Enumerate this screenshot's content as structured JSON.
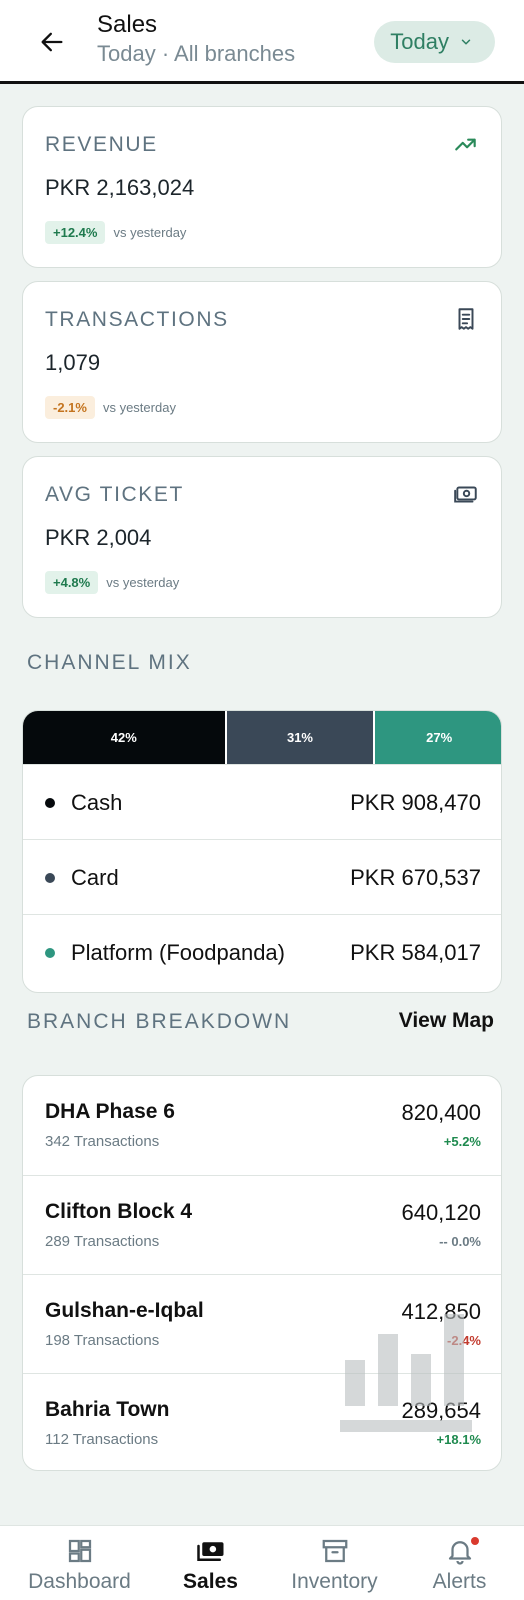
{
  "header": {
    "title": "Sales",
    "subtitle": "Today · All branches",
    "period_label": "Today"
  },
  "kpis": [
    {
      "label": "REVENUE",
      "value": "PKR 2,163,024",
      "change": "+12.4%",
      "direction": "up",
      "compare": "vs yesterday",
      "icon": "trending-up-icon"
    },
    {
      "label": "TRANSACTIONS",
      "value": "1,079",
      "change": "-2.1%",
      "direction": "down",
      "compare": "vs yesterday",
      "icon": "receipt-icon"
    },
    {
      "label": "AVG TICKET",
      "value": "PKR 2,004",
      "change": "+4.8%",
      "direction": "up",
      "compare": "vs yesterday",
      "icon": "cash-icon"
    }
  ],
  "channel_mix": {
    "title": "CHANNEL MIX",
    "segments": [
      {
        "percent_label": "42%",
        "share": 0.42,
        "color": "#05090c"
      },
      {
        "percent_label": "31%",
        "share": 0.31,
        "color": "#3a4857"
      },
      {
        "percent_label": "27%",
        "share": 0.27,
        "color": "#2e9680"
      }
    ],
    "rows": [
      {
        "name": "Cash",
        "amount": "PKR 908,470",
        "color": "#05090c"
      },
      {
        "name": "Card",
        "amount": "PKR 670,537",
        "color": "#3a4857"
      },
      {
        "name": "Platform (Foodpanda)",
        "amount": "PKR 584,017",
        "color": "#2e9680"
      }
    ]
  },
  "branches": {
    "title": "BRANCH BREAKDOWN",
    "view_map_label": "View Map",
    "rows": [
      {
        "name": "DHA Phase 6",
        "transactions": "342 Transactions",
        "amount": "820,400",
        "change": "+5.2%",
        "trend": "pos"
      },
      {
        "name": "Clifton Block 4",
        "transactions": "289 Transactions",
        "amount": "640,120",
        "change": "-- 0.0%",
        "trend": "flat"
      },
      {
        "name": "Gulshan-e-Iqbal",
        "transactions": "198 Transactions",
        "amount": "412,850",
        "change": "-2.4%",
        "trend": "neg"
      },
      {
        "name": "Bahria Town",
        "transactions": "112 Transactions",
        "amount": "289,654",
        "change": "+18.1%",
        "trend": "pos"
      }
    ]
  },
  "bottom_nav": [
    {
      "label": "Dashboard",
      "icon": "dashboard-icon",
      "active": false
    },
    {
      "label": "Sales",
      "icon": "sales-icon",
      "active": true
    },
    {
      "label": "Inventory",
      "icon": "inventory-icon",
      "active": false
    },
    {
      "label": "Alerts",
      "icon": "bell-icon",
      "active": false
    }
  ]
}
